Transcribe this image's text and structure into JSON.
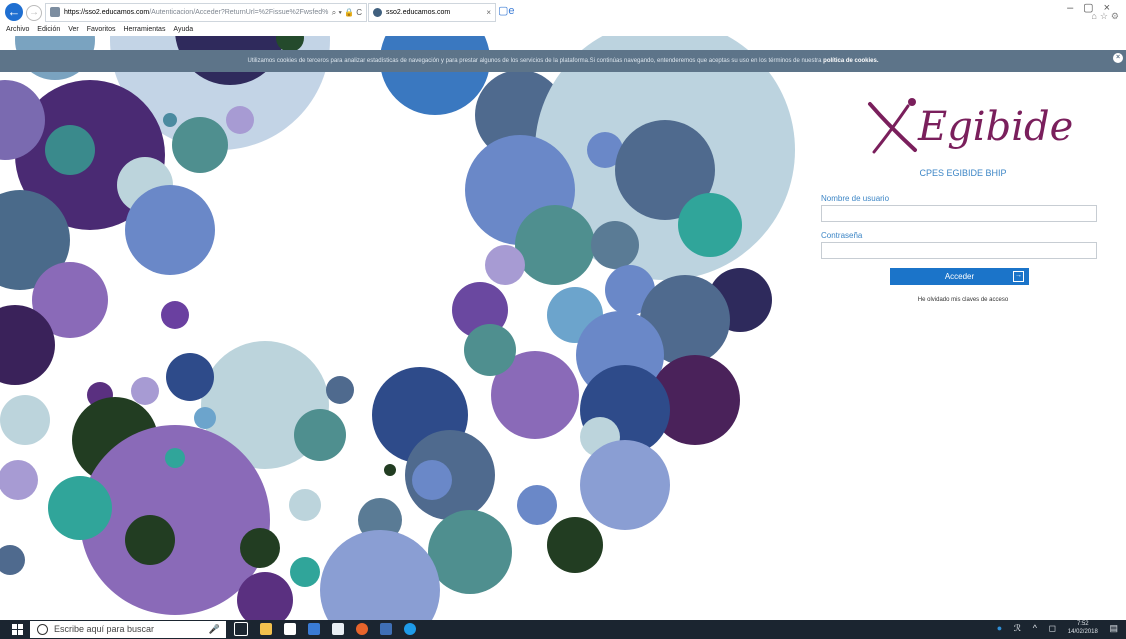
{
  "browser": {
    "address_host": "https://sso2.educamos.com",
    "address_path": "/Autenticacion/Acceder?ReturnUrl=%2Fissue%2Fwsfed%",
    "tab_title": "sso2.educamos.com",
    "menu": [
      "Archivo",
      "Edición",
      "Ver",
      "Favoritos",
      "Herramientas",
      "Ayuda"
    ]
  },
  "cookies": {
    "text": "Utilizamos cookies de terceros para analizar estadísticas de navegación y para prestar algunos de los servicios de la plataforma.Si continúas navegando, entenderemos que aceptas su uso en los términos de nuestra ",
    "link": "política de cookies."
  },
  "login": {
    "logo_text": "Egibide",
    "school_name": "CPES EGIBIDE BHIP",
    "username_label": "Nombre de usuario",
    "username_value": "",
    "password_label": "Contraseña",
    "password_value": "",
    "submit_label": "Acceder",
    "forgot_link": "He olvidado mis claves de acceso"
  },
  "taskbar": {
    "search_placeholder": "Escribe aquí para buscar",
    "time": "7:52",
    "date": "14/02/2018"
  },
  "colors": {
    "accent": "#1b74c9",
    "logo": "#7a1f5c",
    "cookie_bar": "#5d7489",
    "taskbar": "#1b2530"
  }
}
